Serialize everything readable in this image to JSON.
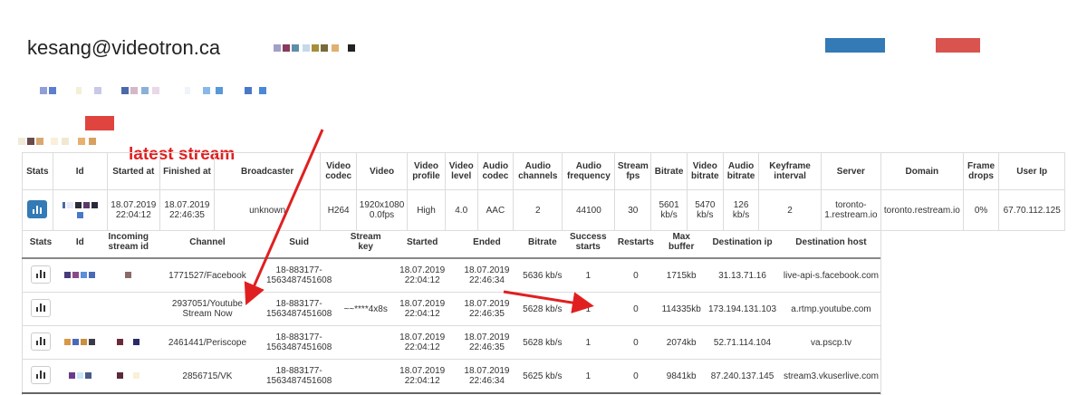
{
  "header": {
    "email": "kesang@videotron.ca",
    "blue_button_color": "#337ab7",
    "red_button_color": "#d9534f"
  },
  "annotation": {
    "latest_label": "latest stream",
    "arrow_color": "#e02020"
  },
  "main_table": {
    "headers": [
      "Stats",
      "Id",
      "Started at",
      "Finished at",
      "Broadcaster",
      "Video codec",
      "Video",
      "Video profile",
      "Video level",
      "Audio codec",
      "Audio channels",
      "Audio frequency",
      "Stream fps",
      "Bitrate",
      "Video bitrate",
      "Audio bitrate",
      "Keyframe interval",
      "Server",
      "Domain",
      "Frame drops",
      "User Ip"
    ],
    "row": {
      "started_at": "18.07.2019 22:04:12",
      "finished_at": "18.07.2019 22:46:35",
      "broadcaster": "unknown",
      "video_codec": "H264",
      "video": "1920x1080 0.0fps",
      "video_profile": "High",
      "video_level": "4.0",
      "audio_codec": "AAC",
      "audio_channels": "2",
      "audio_frequency": "44100",
      "stream_fps": "30",
      "bitrate": "5601 kb/s",
      "video_bitrate": "5470 kb/s",
      "audio_bitrate": "126 kb/s",
      "keyframe_interval": "2",
      "server": "toronto-1.restream.io",
      "domain": "toronto.restream.io",
      "frame_drops": "0%",
      "user_ip": "67.70.112.125"
    }
  },
  "sub_table": {
    "headers": [
      "Stats",
      "Id",
      "Incoming stream id",
      "Channel",
      "Suid",
      "Stream key",
      "Started",
      "Ended",
      "Bitrate",
      "Success starts",
      "Restarts",
      "Max buffer",
      "Destination ip",
      "Destination host"
    ],
    "rows": [
      {
        "channel": "1771527/Facebook",
        "suid": "18-883177-1563487451608",
        "stream_key": "",
        "started": "18.07.2019 22:04:12",
        "ended": "18.07.2019 22:46:34",
        "bitrate": "5636 kb/s",
        "success": "1",
        "restarts": "0",
        "max_buffer": "1715kb",
        "dest_ip": "31.13.71.16",
        "dest_host": "live-api-s.facebook.com"
      },
      {
        "channel": "2937051/Youtube Stream Now",
        "suid": "18-883177-1563487451608",
        "stream_key": "~~****4x8s",
        "started": "18.07.2019 22:04:12",
        "ended": "18.07.2019 22:46:35",
        "bitrate": "5628 kb/s",
        "success": "1",
        "restarts": "0",
        "max_buffer": "114335kb",
        "dest_ip": "173.194.131.103",
        "dest_host": "a.rtmp.youtube.com"
      },
      {
        "channel": "2461441/Periscope",
        "suid": "18-883177-1563487451608",
        "stream_key": "",
        "started": "18.07.2019 22:04:12",
        "ended": "18.07.2019 22:46:35",
        "bitrate": "5628 kb/s",
        "success": "1",
        "restarts": "0",
        "max_buffer": "2074kb",
        "dest_ip": "52.71.114.104",
        "dest_host": "va.pscp.tv"
      },
      {
        "channel": "2856715/VK",
        "suid": "18-883177-1563487451608",
        "stream_key": "",
        "started": "18.07.2019 22:04:12",
        "ended": "18.07.2019 22:46:34",
        "bitrate": "5625 kb/s",
        "success": "1",
        "restarts": "0",
        "max_buffer": "9841kb",
        "dest_ip": "87.240.137.145",
        "dest_host": "stream3.vkuserlive.com"
      }
    ]
  }
}
